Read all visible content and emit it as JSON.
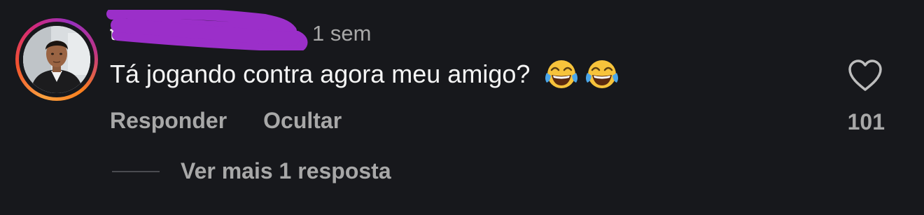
{
  "comment": {
    "username": "ta",
    "timestamp": "1 sem",
    "text": "Tá jogando contra agora meu amigo?",
    "emojis": [
      "face-with-tears-of-joy",
      "face-with-tears-of-joy"
    ],
    "like_count": "101"
  },
  "actions": {
    "reply_label": "Responder",
    "hide_label": "Ocultar"
  },
  "replies": {
    "view_more_label": "Ver mais 1 resposta"
  },
  "colors": {
    "background": "#17181c",
    "text_primary": "#f5f5f5",
    "text_secondary": "#a8a8a8",
    "redaction": "#9b2fc9"
  }
}
